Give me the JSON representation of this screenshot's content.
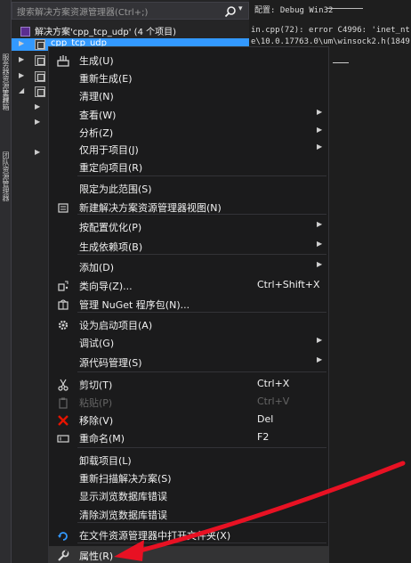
{
  "left_strip": {
    "tabs": [
      "服务器资源管理器",
      "工具箱",
      "团队资源管理器"
    ]
  },
  "solution_explorer": {
    "search_placeholder": "搜索解决方案资源管理器(Ctrl+;)",
    "search_dropdown": "▾",
    "solution_label": "解决方案'cpp_tcp_udp' (4 个项目)",
    "selected_project": "cpp_tcp_udp"
  },
  "output": {
    "config": "配置: Debug Win32",
    "lines": [
      "in.cpp(72): error C4996: 'inet_nt",
      "e\\10.0.17763.0\\um\\winsock2.h(1849"
    ]
  },
  "menu": {
    "items": [
      {
        "label": "生成(U)",
        "shortcut": "",
        "submenu": false,
        "icon": "build-icon"
      },
      {
        "label": "重新生成(E)",
        "shortcut": "",
        "submenu": false,
        "icon": ""
      },
      {
        "label": "清理(N)",
        "shortcut": "",
        "submenu": false,
        "icon": ""
      },
      {
        "label": "查看(W)",
        "shortcut": "",
        "submenu": true,
        "icon": ""
      },
      {
        "label": "分析(Z)",
        "shortcut": "",
        "submenu": true,
        "icon": ""
      },
      {
        "label": "仅用于项目(J)",
        "shortcut": "",
        "submenu": true,
        "icon": ""
      },
      {
        "label": "重定向项目(R)",
        "shortcut": "",
        "submenu": false,
        "icon": ""
      },
      {
        "label": "限定为此范围(S)",
        "shortcut": "",
        "submenu": false,
        "icon": ""
      },
      {
        "label": "新建解决方案资源管理器视图(N)",
        "shortcut": "",
        "submenu": false,
        "icon": "new-view-icon"
      },
      {
        "label": "按配置优化(P)",
        "shortcut": "",
        "submenu": true,
        "icon": ""
      },
      {
        "label": "生成依赖项(B)",
        "shortcut": "",
        "submenu": true,
        "icon": ""
      },
      {
        "label": "添加(D)",
        "shortcut": "",
        "submenu": true,
        "icon": ""
      },
      {
        "label": "类向导(Z)...",
        "shortcut": "Ctrl+Shift+X",
        "submenu": false,
        "icon": "class-wizard-icon"
      },
      {
        "label": "管理 NuGet 程序包(N)...",
        "shortcut": "",
        "submenu": false,
        "icon": "nuget-icon"
      },
      {
        "label": "设为启动项目(A)",
        "shortcut": "",
        "submenu": false,
        "icon": "gear-icon"
      },
      {
        "label": "调试(G)",
        "shortcut": "",
        "submenu": true,
        "icon": ""
      },
      {
        "label": "源代码管理(S)",
        "shortcut": "",
        "submenu": true,
        "icon": ""
      },
      {
        "label": "剪切(T)",
        "shortcut": "Ctrl+X",
        "submenu": false,
        "icon": "scissors-icon"
      },
      {
        "label": "粘贴(P)",
        "shortcut": "Ctrl+V",
        "submenu": false,
        "icon": "paste-icon",
        "disabled": true
      },
      {
        "label": "移除(V)",
        "shortcut": "Del",
        "submenu": false,
        "icon": "remove-icon"
      },
      {
        "label": "重命名(M)",
        "shortcut": "F2",
        "submenu": false,
        "icon": "rename-icon"
      },
      {
        "label": "卸载项目(L)",
        "shortcut": "",
        "submenu": false,
        "icon": ""
      },
      {
        "label": "重新扫描解决方案(S)",
        "shortcut": "",
        "submenu": false,
        "icon": ""
      },
      {
        "label": "显示浏览数据库错误",
        "shortcut": "",
        "submenu": false,
        "icon": ""
      },
      {
        "label": "清除浏览数据库错误",
        "shortcut": "",
        "submenu": false,
        "icon": ""
      },
      {
        "label": "在文件资源管理器中打开文件夹(X)",
        "shortcut": "",
        "submenu": false,
        "icon": "open-folder-icon"
      },
      {
        "label": "属性(R)",
        "shortcut": "",
        "submenu": false,
        "icon": "wrench-icon",
        "highlighted": true
      }
    ],
    "submenu_glyph": "▶",
    "tree_arrow": "▶",
    "tree_arrow_open": "◢"
  },
  "colors": {
    "accent": "#3399ff",
    "annotation": "#e81123",
    "menu_bg": "#1b1b1c",
    "remove_icon": "#e51400"
  }
}
